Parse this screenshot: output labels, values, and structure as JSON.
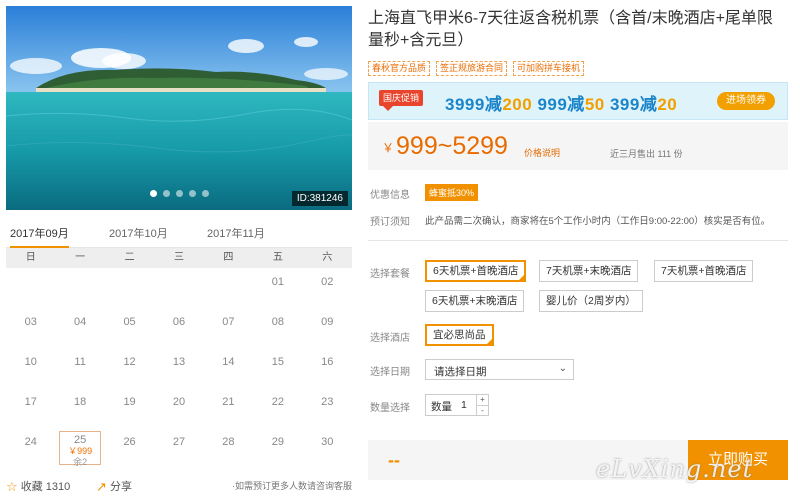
{
  "gallery": {
    "image_id": "ID:381246",
    "slide_count": 5,
    "active_slide": 1
  },
  "calendar": {
    "months": [
      "2017年09月",
      "2017年10月",
      "2017年11月"
    ],
    "active_month": 0,
    "weekdays": [
      "日",
      "一",
      "二",
      "三",
      "四",
      "五",
      "六"
    ],
    "days": [
      [
        "",
        "",
        "",
        "",
        "",
        "01",
        "02"
      ],
      [
        "03",
        "04",
        "05",
        "06",
        "07",
        "08",
        "09"
      ],
      [
        "10",
        "11",
        "12",
        "13",
        "14",
        "15",
        "16"
      ],
      [
        "17",
        "18",
        "19",
        "20",
        "21",
        "22",
        "23"
      ],
      [
        "24",
        "25",
        "26",
        "27",
        "28",
        "29",
        "30"
      ]
    ],
    "selected_day": {
      "day": "25",
      "price": "￥999",
      "remaining": "余2"
    }
  },
  "footer": {
    "favorite_label": "收藏",
    "favorite_count": "1310",
    "share_label": "分享",
    "note": "·如需预订更多人数请咨询客服"
  },
  "product": {
    "title": "上海直飞甲米6-7天往返含税机票（含首/末晚酒店+尾单限量秒+含元旦）",
    "tags": [
      "春秋官方品质",
      "签正规旅游合同",
      "可加购拼车接机"
    ],
    "promo": {
      "badge": "国庆促销",
      "offers": [
        {
          "threshold": "3999减",
          "amount": "200"
        },
        {
          "threshold": "999减",
          "amount": "50"
        },
        {
          "threshold": "399减",
          "amount": "20"
        }
      ],
      "button": "进场领券"
    },
    "price": {
      "currency": "￥",
      "range": "999~5299",
      "note": "价格说明",
      "sold": "近三月售出 111 份"
    },
    "discount": {
      "label": "优惠信息",
      "badge": "蜂蜜抵30%"
    },
    "booking": {
      "label": "预订须知",
      "text": "此产品需二次确认，商家将在5个工作小时内（工作日9:00-22:00）核实是否有位。"
    },
    "packages": {
      "label": "选择套餐",
      "options": [
        "6天机票+首晚酒店",
        "7天机票+末晚酒店",
        "7天机票+首晚酒店",
        "6天机票+末晚酒店",
        "婴儿价（2周岁内）"
      ],
      "selected": 0
    },
    "hotel": {
      "label": "选择酒店",
      "option": "宜必思尚品"
    },
    "date": {
      "label": "选择日期",
      "value": "请选择日期"
    },
    "quantity": {
      "label": "数量选择",
      "inline_label": "数量",
      "value": "1",
      "plus": "+",
      "minus": "-"
    },
    "buy": {
      "total": "--",
      "button": "立即购买"
    }
  },
  "watermark": "eLvXing.net",
  "colors": {
    "accent": "#f29100",
    "price": "#e86b00",
    "promo_blue": "#1b85c9",
    "promo_red": "#e9452c"
  }
}
